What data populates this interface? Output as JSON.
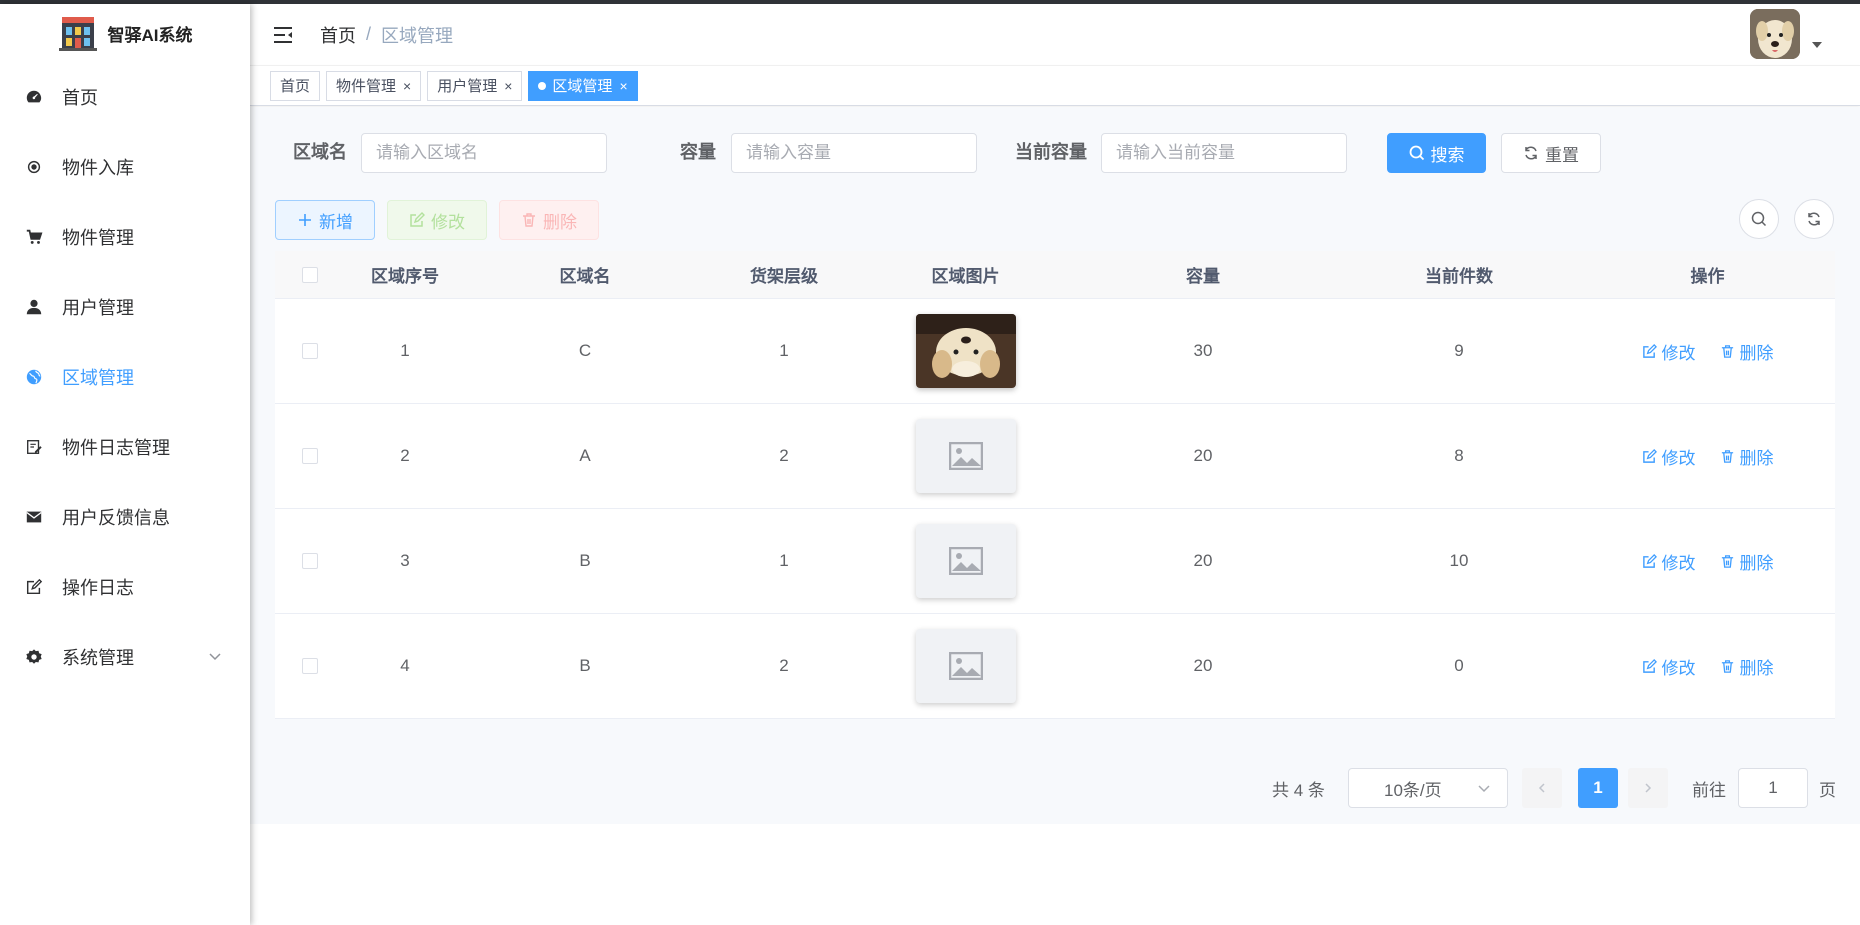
{
  "app": {
    "title": "智驿AI系统"
  },
  "sidebar": {
    "items": [
      {
        "label": "首页",
        "icon": "dashboard-icon"
      },
      {
        "label": "物件入库",
        "icon": "radio-icon"
      },
      {
        "label": "物件管理",
        "icon": "cart-icon"
      },
      {
        "label": "用户管理",
        "icon": "user-icon"
      },
      {
        "label": "区域管理",
        "icon": "globe-icon",
        "active": true
      },
      {
        "label": "物件日志管理",
        "icon": "log-edit-icon"
      },
      {
        "label": "用户反馈信息",
        "icon": "mail-icon"
      },
      {
        "label": "操作日志",
        "icon": "form-icon"
      },
      {
        "label": "系统管理",
        "icon": "gear-icon",
        "has_children": true
      }
    ]
  },
  "header": {
    "breadcrumb": {
      "home": "首页",
      "separator": "/",
      "current": "区域管理"
    }
  },
  "tags": [
    {
      "label": "首页",
      "closable": false
    },
    {
      "label": "物件管理",
      "closable": true,
      "close": "×"
    },
    {
      "label": "用户管理",
      "closable": true,
      "close": "×"
    },
    {
      "label": "区域管理",
      "closable": true,
      "active": true,
      "close": "×"
    }
  ],
  "search": {
    "fields": [
      {
        "label": "区域名",
        "placeholder": "请输入区域名"
      },
      {
        "label": "容量",
        "placeholder": "请输入容量"
      },
      {
        "label": "当前容量",
        "placeholder": "请输入当前容量"
      }
    ],
    "search_label": "搜索",
    "reset_label": "重置"
  },
  "toolbar": {
    "add_label": "新增",
    "edit_label": "修改",
    "delete_label": "删除"
  },
  "table": {
    "columns": [
      "区域序号",
      "区域名",
      "货架层级",
      "区域图片",
      "容量",
      "当前件数",
      "操作"
    ],
    "rows": [
      {
        "id": "1",
        "name": "C",
        "level": "1",
        "image": "dog-photo",
        "capacity": "30",
        "count": "9"
      },
      {
        "id": "2",
        "name": "A",
        "level": "2",
        "image": "placeholder",
        "capacity": "20",
        "count": "8"
      },
      {
        "id": "3",
        "name": "B",
        "level": "1",
        "image": "placeholder",
        "capacity": "20",
        "count": "10"
      },
      {
        "id": "4",
        "name": "B",
        "level": "2",
        "image": "placeholder",
        "capacity": "20",
        "count": "0"
      }
    ],
    "row_edit_label": "修改",
    "row_delete_label": "删除"
  },
  "pagination": {
    "total_text": "共 4 条",
    "page_size": "10条/页",
    "current_page": "1",
    "goto_label": "前往",
    "goto_value": "1",
    "page_suffix": "页"
  },
  "colors": {
    "primary": "#409eff",
    "success_plain": "#b3e19d",
    "danger_plain": "#fab6b6"
  }
}
